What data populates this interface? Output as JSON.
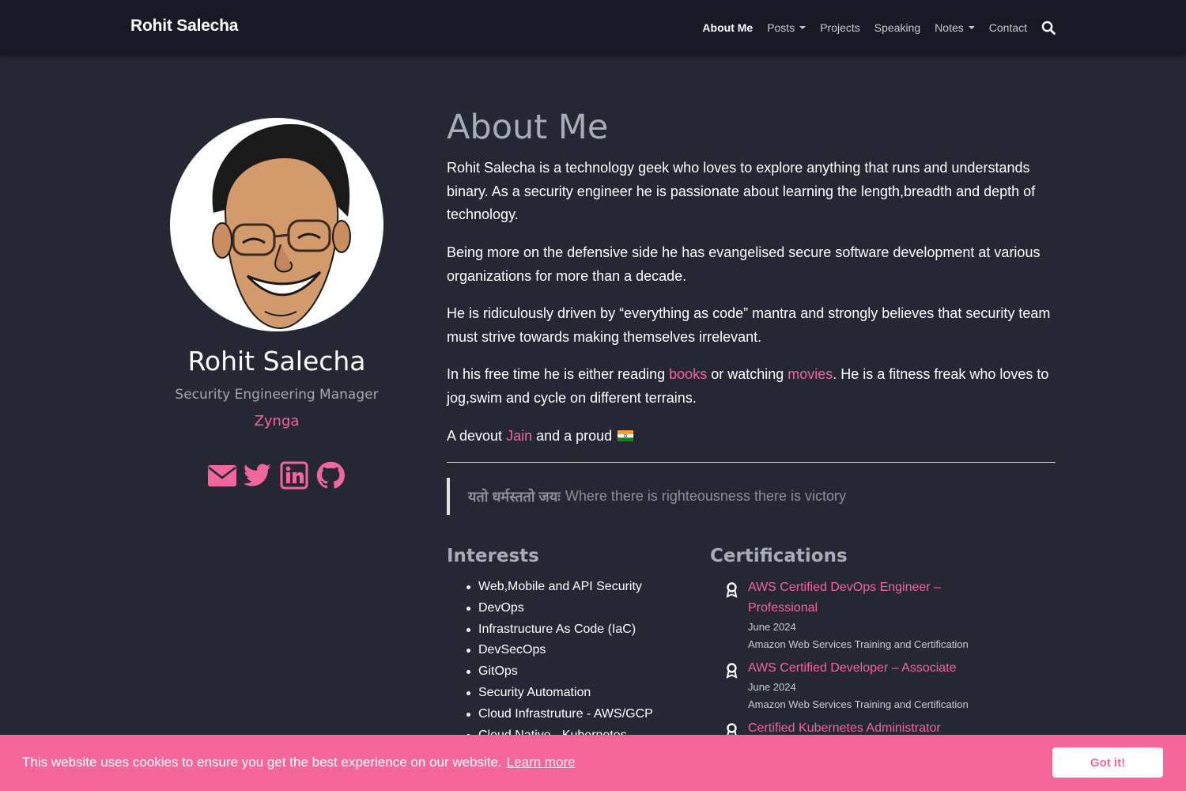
{
  "navbar": {
    "brand": "Rohit Salecha",
    "items": [
      {
        "label": "About Me",
        "active": true,
        "dropdown": false
      },
      {
        "label": "Posts",
        "active": false,
        "dropdown": true
      },
      {
        "label": "Projects",
        "active": false,
        "dropdown": false
      },
      {
        "label": "Speaking",
        "active": false,
        "dropdown": false
      },
      {
        "label": "Notes",
        "active": false,
        "dropdown": true
      },
      {
        "label": "Contact",
        "active": false,
        "dropdown": false
      }
    ],
    "search_icon": "search-icon"
  },
  "profile": {
    "name": "Rohit Salecha",
    "title": "Security Engineering Manager",
    "company": "Zynga",
    "social_icons": [
      "envelope-icon",
      "twitter-icon",
      "linkedin-icon",
      "github-icon"
    ]
  },
  "about": {
    "heading": "About Me",
    "p1": "Rohit Salecha is a technology geek who loves to explore anything that runs and understands binary. As a security engineer he is passionate about learning the length,breadth and depth of technology.",
    "p2": "Being more on the defensive side he has evangelised secure software development at various organizations for more than a decade.",
    "p3": "He is ridiculously driven by “everything as code” mantra and strongly believes that security team must strive towards making themselves irrelevant.",
    "p4": {
      "before": "In his free time he is either reading ",
      "link1": "books",
      "middle": " or watching ",
      "link2": "movies",
      "after": ". He is a fitness freak who loves to jog,swim and cycle on different terrains."
    },
    "p5": {
      "before": "A devout ",
      "link": "Jain",
      "after": " and a proud ",
      "flag_icon": "india-flag-icon"
    },
    "quote": {
      "sanskrit": "यतो धर्मस्ततो जयः",
      "text": "Where there is righteousness there is victory"
    }
  },
  "interests": {
    "heading": "Interests",
    "items": [
      "Web,Mobile and API Security",
      "DevOps",
      "Infrastructure As Code (IaC)",
      "DevSecOps",
      "GitOps",
      "Security Automation",
      "Cloud Infrastruture - AWS/GCP",
      "Cloud Native - Kubernetes"
    ]
  },
  "certifications": {
    "heading": "Certifications",
    "items": [
      {
        "name": "AWS Certified DevOps Engineer – Professional",
        "date": "June 2024",
        "issuer": "Amazon Web Services Training and Certification"
      },
      {
        "name": "AWS Certified Developer – Associate",
        "date": "June 2024",
        "issuer": "Amazon Web Services Training and Certification"
      },
      {
        "name": "Certified Kubernetes Administrator",
        "date": "",
        "issuer": ""
      }
    ]
  },
  "cookie": {
    "text": "This website uses cookies to ensure you get the best experience on our website.",
    "learn_more": "Learn more",
    "button": "Got it!"
  },
  "colors": {
    "accent": "#f0669d",
    "background": "#252834",
    "navbar": "#171a26",
    "heading": "#a4adb8"
  }
}
